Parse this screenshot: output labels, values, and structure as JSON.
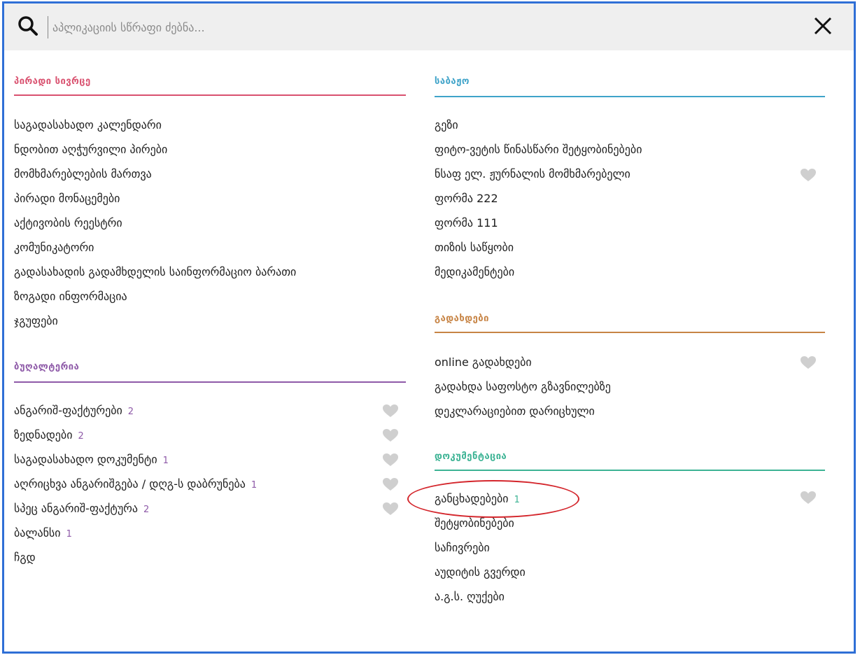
{
  "search": {
    "placeholder": "აპლიკაციის სწრაფი ძებნა..."
  },
  "icons": {
    "search": "search-icon",
    "close": "close-icon",
    "favorite": "heart-icon"
  },
  "colors": {
    "personal": "#d9516f",
    "accounting": "#8e5aa8",
    "customs": "#3fa3c9",
    "payments": "#c78445",
    "documentation": "#3cb394",
    "cutoff_section": "#e0c23a",
    "highlight": "#d4262c",
    "heart": "#cfcfcf"
  },
  "left": {
    "personal": {
      "title": "პირადი სივრცე",
      "items": [
        {
          "label": "საგადასახადო კალენდარი"
        },
        {
          "label": "ნდობით აღჭურვილი პირები"
        },
        {
          "label": "მომხმარებლების მართვა"
        },
        {
          "label": "პირადი მონაცემები"
        },
        {
          "label": "აქტივობის რეესტრი"
        },
        {
          "label": "კომუნიკატორი"
        },
        {
          "label": "გადასახადის გადამხდელის საინფორმაციო ბარათი"
        },
        {
          "label": "ზოგადი ინფორმაცია"
        },
        {
          "label": "ჯგუფები"
        }
      ]
    },
    "accounting": {
      "title": "ბუღალტერია",
      "items": [
        {
          "label": "ანგარიშ-ფაქტურები",
          "count": "2"
        },
        {
          "label": "ზედნადები",
          "count": "2"
        },
        {
          "label": "საგადასახადო დოკუმენტი",
          "count": "1"
        },
        {
          "label": "აღრიცხვა ანგარიშგება / დღგ-ს დაბრუნება",
          "count": "1"
        },
        {
          "label": "სპეც ანგარიშ-ფაქტურა",
          "count": "2"
        },
        {
          "label": "ბალანსი",
          "count": "1"
        },
        {
          "label": "ჩგდ"
        }
      ]
    }
  },
  "right": {
    "customs": {
      "title": "საბაჟო",
      "items": [
        {
          "label": "გეზი"
        },
        {
          "label": "ფიტო-ვეტის წინასწარი შეტყობინებები"
        },
        {
          "label": "ნსაფ ელ. ჟურნალის მომხმარებელი"
        },
        {
          "label": "ფორმა 222"
        },
        {
          "label": "ფორმა 111"
        },
        {
          "label": "თიზის საწყობი"
        },
        {
          "label": "მედიკამენტები"
        }
      ]
    },
    "payments": {
      "title": "გადახდები",
      "items": [
        {
          "label": "online გადახდები"
        },
        {
          "label": "გადახდა საფოსტო გზავნილებზე"
        },
        {
          "label": "დეკლარაციებით დარიცხული"
        }
      ]
    },
    "documentation": {
      "title": "დოკუმენტაცია",
      "items": [
        {
          "label": "განცხადებები",
          "count": "1"
        },
        {
          "label": "შეტყობინებები"
        },
        {
          "label": "საჩივრები"
        },
        {
          "label": "აუდიტის გვერდი"
        },
        {
          "label": "ა.გ.ს. ღუქები"
        }
      ]
    }
  }
}
